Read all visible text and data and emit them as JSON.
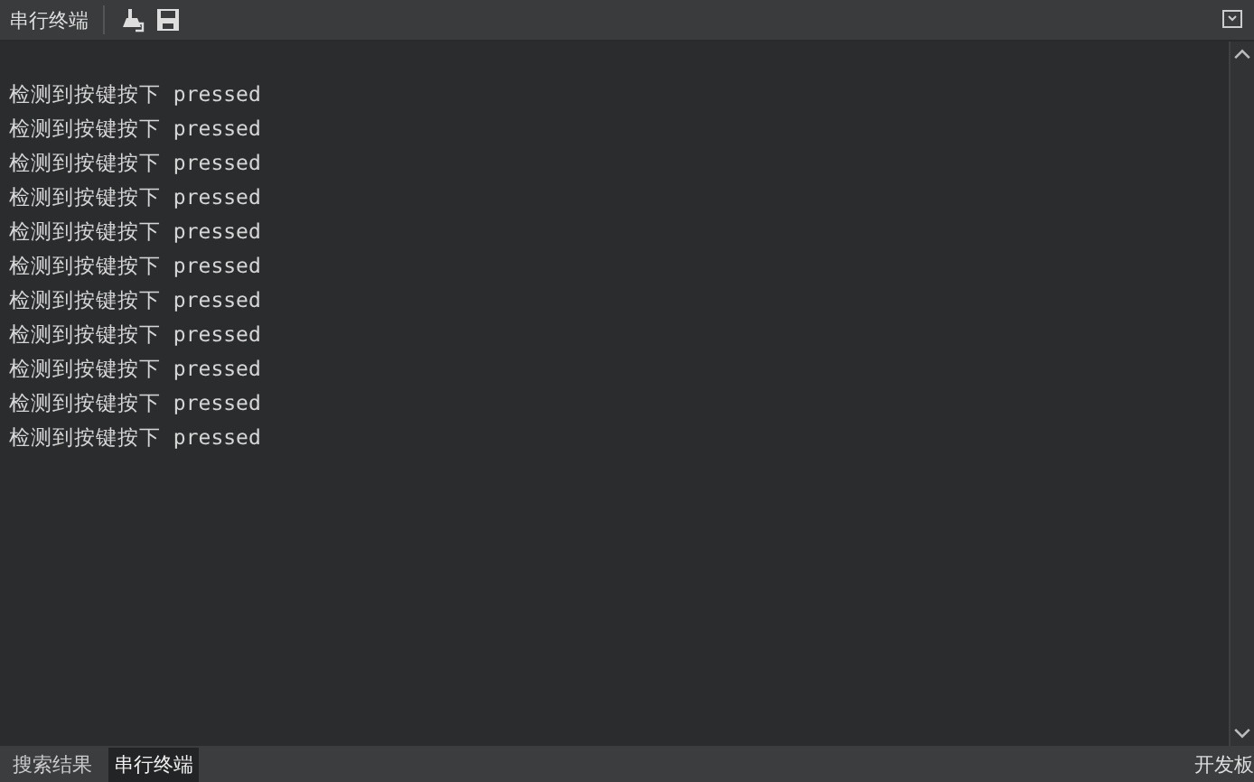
{
  "toolbar": {
    "title": "串行终端"
  },
  "console": {
    "lines": [
      {
        "label": "检测到按键按下",
        "value": "pressed"
      },
      {
        "label": "检测到按键按下",
        "value": "pressed"
      },
      {
        "label": "检测到按键按下",
        "value": "pressed"
      },
      {
        "label": "检测到按键按下",
        "value": "pressed"
      },
      {
        "label": "检测到按键按下",
        "value": "pressed"
      },
      {
        "label": "检测到按键按下",
        "value": "pressed"
      },
      {
        "label": "检测到按键按下",
        "value": "pressed"
      },
      {
        "label": "检测到按键按下",
        "value": "pressed"
      },
      {
        "label": "检测到按键按下",
        "value": "pressed"
      },
      {
        "label": "检测到按键按下",
        "value": "pressed"
      },
      {
        "label": "检测到按键按下",
        "value": "pressed"
      }
    ]
  },
  "bottom_tabs": [
    {
      "label": "搜索结果",
      "selected": false
    },
    {
      "label": "串行终端",
      "selected": true
    }
  ],
  "right_label": "开发板"
}
